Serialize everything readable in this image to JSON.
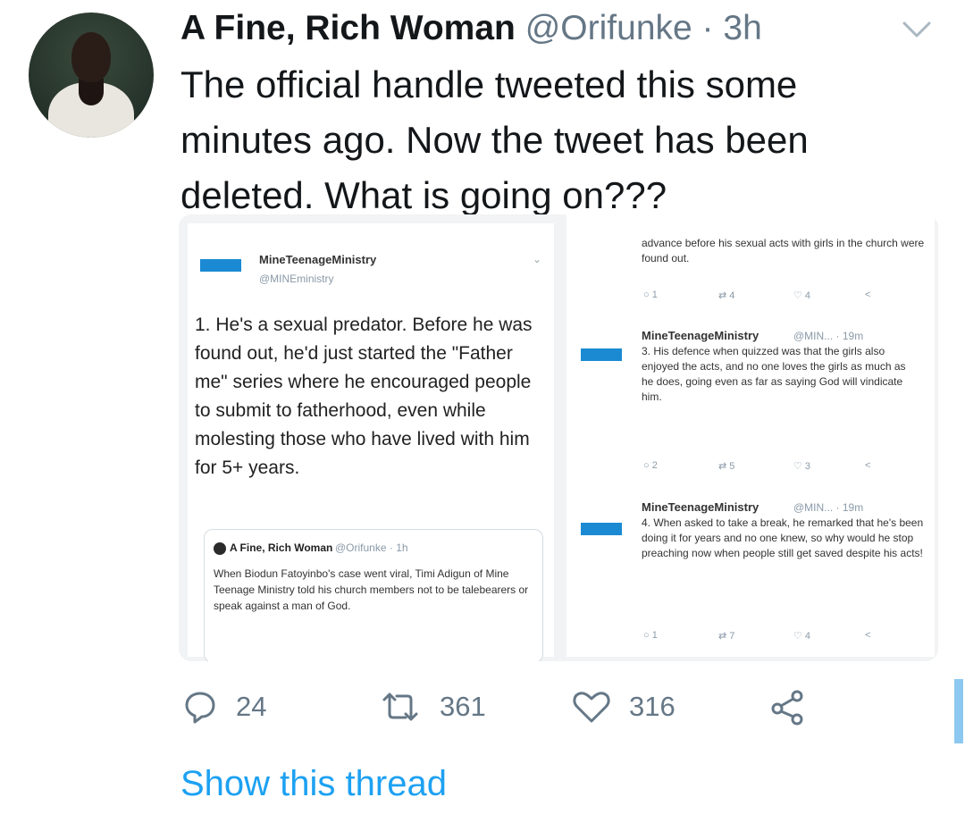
{
  "tweet": {
    "display_name": "A Fine, Rich Woman",
    "handle": "@Orifunke",
    "separator": "·",
    "time": "3h",
    "text": "The official handle tweeted this some minutes ago. Now the tweet has been deleted. What is going on???",
    "show_thread": "Show this thread",
    "replies": "24",
    "retweets": "361",
    "likes": "316"
  },
  "media": {
    "left": {
      "account_name": "MineTeenageMinistry",
      "account_handle": "@MINEministry",
      "body": "1. He's a sexual predator. Before he was found out, he'd just started the \"Father me\" series where he encouraged people to submit to fatherhood, even while molesting those who have lived with him for 5+ years.",
      "quote": {
        "name": "A Fine, Rich Woman",
        "handle": "@Orifunke · 1h",
        "text": "When Biodun Fatoyinbo's case went viral, Timi Adigun of Mine Teenage Ministry told his church members not to be talebearers or speak against a man of God."
      }
    },
    "right": {
      "top_fragment": "advance before his sexual acts with girls in the church were found out.",
      "top_counts": [
        "1",
        "4",
        "4"
      ],
      "tweet3": {
        "name": "MineTeenageMinistry",
        "handle": "@MIN... · 19m",
        "text": "3. His defence when quizzed was that the girls also enjoyed the acts, and no one loves the girls as much as he does, going even as far as saying God will vindicate him.",
        "counts": [
          "2",
          "5",
          "3"
        ]
      },
      "tweet4": {
        "name": "MineTeenageMinistry",
        "handle": "@MIN... · 19m",
        "text": "4. When asked to take a break, he remarked that he's been doing it for years and no one knew, so why would he stop preaching now when people still get saved despite his acts!",
        "counts": [
          "1",
          "7",
          "4"
        ]
      }
    }
  },
  "colors": {
    "accent": "#1da1f2",
    "secondary_text": "#657786",
    "primary_text": "#14171a"
  },
  "icons": [
    "chevron-down-icon",
    "reply-icon",
    "retweet-icon",
    "like-icon",
    "share-icon"
  ]
}
